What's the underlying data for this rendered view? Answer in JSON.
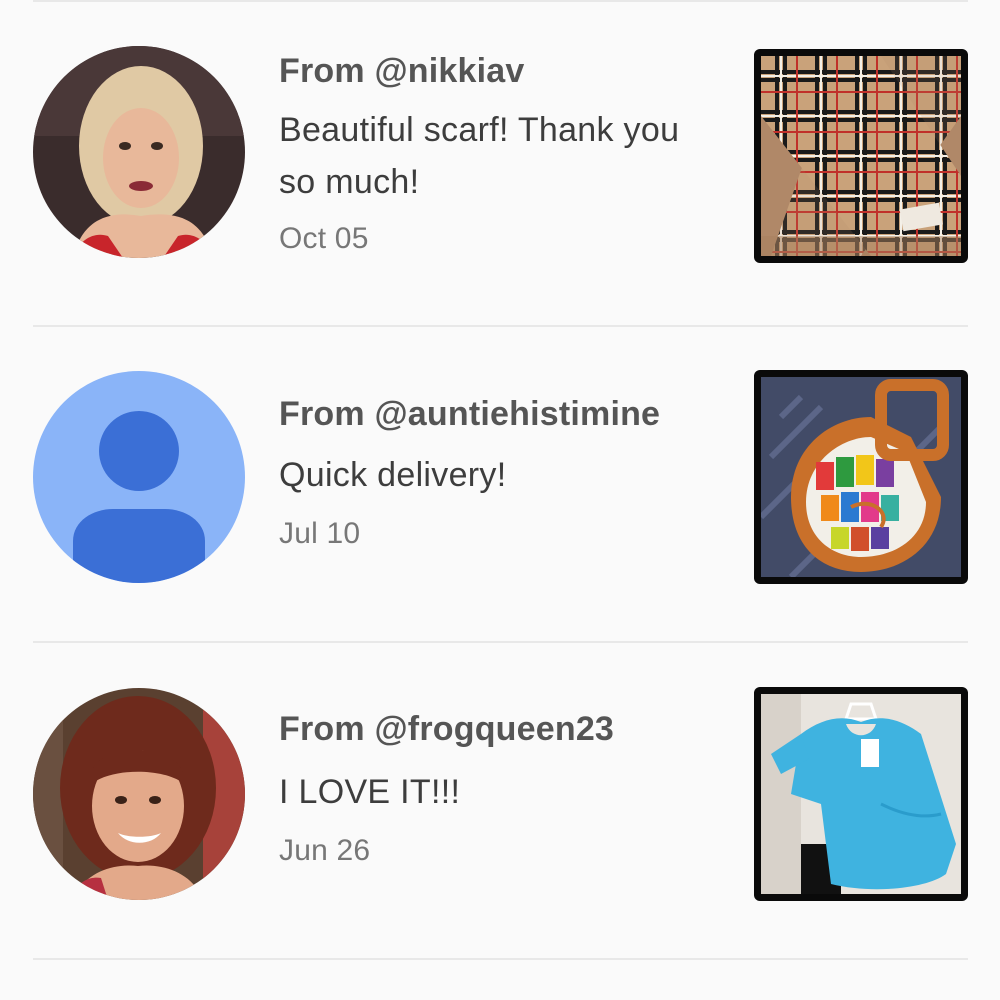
{
  "reviews": [
    {
      "from": "From @nikkiav",
      "text": "Beautiful scarf! Thank you so much!",
      "date": "Oct 05",
      "avatar": "user-photo-avatar",
      "item": "plaid-scarf-photo"
    },
    {
      "from": "From @auntiehistimine",
      "text": "Quick delivery!",
      "date": "Jul 10",
      "avatar": "default-person-icon",
      "item": "colorful-handbag-photo"
    },
    {
      "from": "From @frogqueen23",
      "text": "I LOVE IT!!!",
      "date": "Jun 26",
      "avatar": "user-photo-avatar",
      "item": "blue-top-photo"
    }
  ],
  "colors": {
    "background": "#fafafa",
    "default_avatar_bg": "#8ab4f8",
    "default_avatar_fg": "#3b6fd6",
    "name_text": "#555555",
    "date_text": "#777777"
  }
}
